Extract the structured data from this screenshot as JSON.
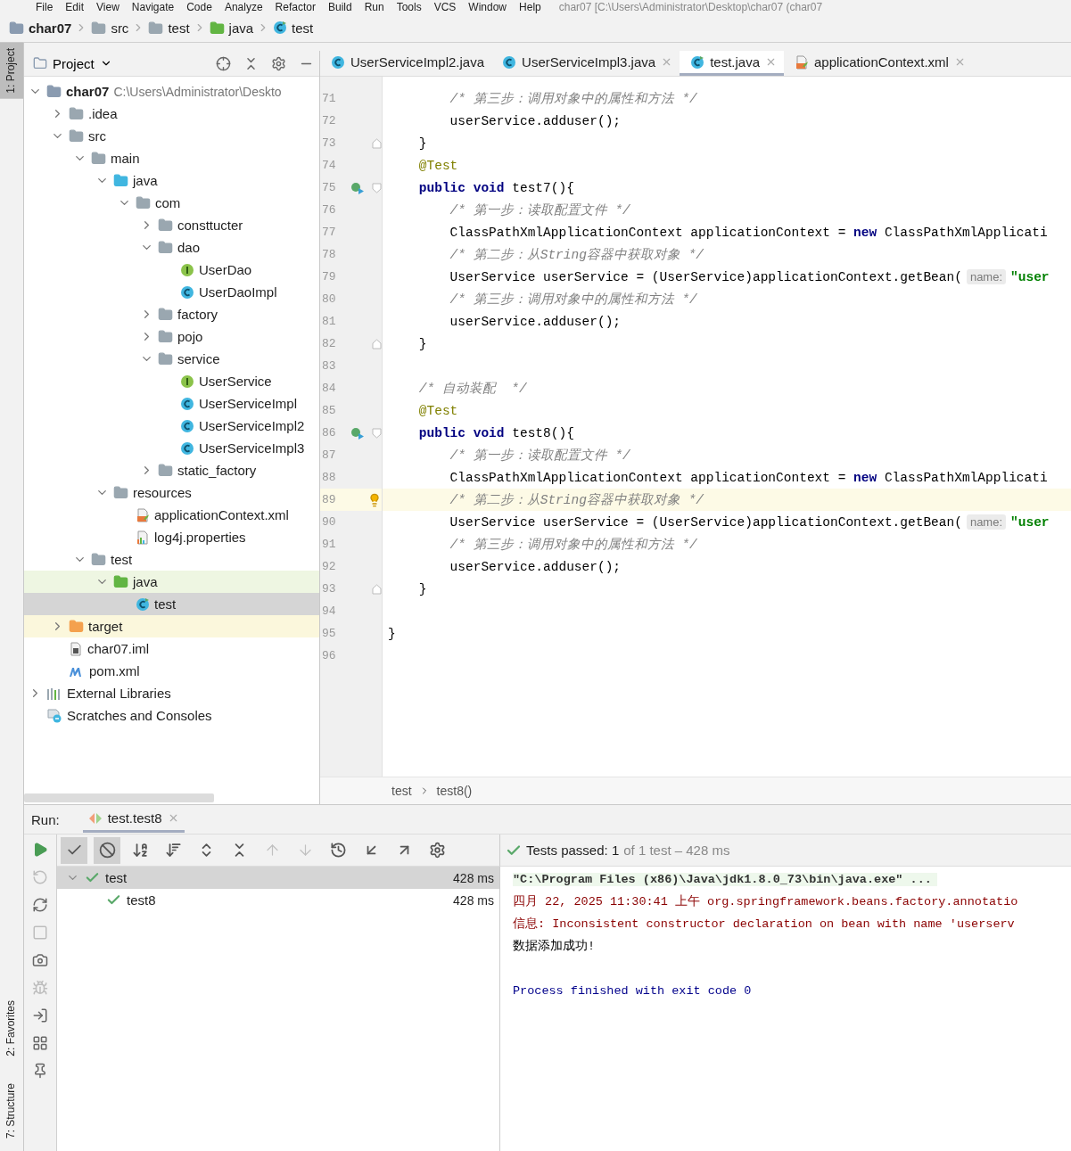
{
  "menu": {
    "items": [
      "File",
      "Edit",
      "View",
      "Navigate",
      "Code",
      "Analyze",
      "Refactor",
      "Build",
      "Run",
      "Tools",
      "VCS",
      "Window",
      "Help"
    ],
    "title": "char07 [C:\\Users\\Administrator\\Desktop\\char07 (char07"
  },
  "breadcrumbs": [
    {
      "label": "char07",
      "kind": "module"
    },
    {
      "label": "src",
      "kind": "folder"
    },
    {
      "label": "test",
      "kind": "folder"
    },
    {
      "label": "java",
      "kind": "test-root"
    },
    {
      "label": "test",
      "kind": "test-class"
    }
  ],
  "tool_windows": {
    "top": [
      {
        "label": "1: Project",
        "selected": true
      }
    ],
    "bottom": [
      {
        "label": "2: Favorites",
        "selected": false
      },
      {
        "label": "7: Structure",
        "selected": false
      }
    ]
  },
  "project": {
    "title": "Project",
    "tree": [
      {
        "label": "char07",
        "kind": "module",
        "detail": "C:\\Users\\Administrator\\Deskto",
        "expanded": true,
        "selected": false,
        "children": [
          {
            "label": ".idea",
            "kind": "folder",
            "expanded": false,
            "selected": false
          },
          {
            "label": "src",
            "kind": "folder",
            "expanded": true,
            "selected": false,
            "children": [
              {
                "label": "main",
                "kind": "folder",
                "expanded": true,
                "selected": false,
                "children": [
                  {
                    "label": "java",
                    "kind": "source-root",
                    "expanded": true,
                    "selected": false,
                    "children": [
                      {
                        "label": "com",
                        "kind": "package",
                        "expanded": true,
                        "selected": false,
                        "children": [
                          {
                            "label": "consttucter",
                            "kind": "package",
                            "expanded": false,
                            "selected": false
                          },
                          {
                            "label": "dao",
                            "kind": "package",
                            "expanded": true,
                            "selected": false,
                            "children": [
                              {
                                "label": "UserDao",
                                "kind": "interface",
                                "selected": false
                              },
                              {
                                "label": "UserDaoImpl",
                                "kind": "class",
                                "selected": false
                              }
                            ]
                          },
                          {
                            "label": "factory",
                            "kind": "package",
                            "expanded": false,
                            "selected": false
                          },
                          {
                            "label": "pojo",
                            "kind": "package",
                            "expanded": false,
                            "selected": false
                          },
                          {
                            "label": "service",
                            "kind": "package",
                            "expanded": true,
                            "selected": false,
                            "children": [
                              {
                                "label": "UserService",
                                "kind": "interface",
                                "selected": false
                              },
                              {
                                "label": "UserServiceImpl",
                                "kind": "class",
                                "selected": false
                              },
                              {
                                "label": "UserServiceImpl2",
                                "kind": "class",
                                "selected": false
                              },
                              {
                                "label": "UserServiceImpl3",
                                "kind": "class",
                                "selected": false
                              }
                            ]
                          },
                          {
                            "label": "static_factory",
                            "kind": "package",
                            "expanded": false,
                            "selected": false
                          }
                        ]
                      }
                    ]
                  },
                  {
                    "label": "resources",
                    "kind": "resources-root",
                    "expanded": true,
                    "selected": false,
                    "children": [
                      {
                        "label": "applicationContext.xml",
                        "kind": "xml",
                        "selected": false
                      },
                      {
                        "label": "log4j.properties",
                        "kind": "properties",
                        "selected": false
                      }
                    ]
                  }
                ]
              },
              {
                "label": "test",
                "kind": "folder",
                "expanded": true,
                "selected": false,
                "children": [
                  {
                    "label": "java",
                    "kind": "test-root",
                    "expanded": true,
                    "selected": false,
                    "children": [
                      {
                        "label": "test",
                        "kind": "test-class",
                        "selected": true
                      }
                    ]
                  }
                ]
              }
            ]
          },
          {
            "label": "target",
            "kind": "excluded",
            "expanded": false,
            "selected": false
          },
          {
            "label": "char07.iml",
            "kind": "iml",
            "selected": false
          },
          {
            "label": "pom.xml",
            "kind": "maven",
            "selected": false
          }
        ]
      },
      {
        "label": "External Libraries",
        "kind": "libraries",
        "expanded": false,
        "selected": false
      },
      {
        "label": "Scratches and Consoles",
        "kind": "scratches",
        "selected": false
      }
    ]
  },
  "editor": {
    "tabs": [
      {
        "label": "UserServiceImpl2.java",
        "kind": "class",
        "selected": false,
        "closable": false
      },
      {
        "label": "UserServiceImpl3.java",
        "kind": "class",
        "selected": false,
        "closable": true
      },
      {
        "label": "test.java",
        "kind": "test-class",
        "selected": true,
        "closable": true
      },
      {
        "label": "applicationContext.xml",
        "kind": "xml",
        "selected": false,
        "closable": true
      }
    ],
    "lines": [
      {
        "n": "71",
        "current": false,
        "tokens": [
          {
            "kind": "comment",
            "text": "        /* 第三步：调用对象中的属性和方法 */"
          }
        ]
      },
      {
        "n": "72",
        "current": false,
        "tokens": [
          {
            "kind": "plain",
            "text": "        userService.adduser();"
          }
        ]
      },
      {
        "n": "73",
        "current": false,
        "gutter": [
          {
            "kind": "fold-end"
          }
        ],
        "tokens": [
          {
            "kind": "plain",
            "text": "    }"
          }
        ]
      },
      {
        "n": "74",
        "current": false,
        "tokens": [
          {
            "kind": "annotation",
            "text": "    @Test"
          }
        ]
      },
      {
        "n": "75",
        "current": false,
        "gutter": [
          {
            "kind": "run"
          },
          {
            "kind": "fold-start"
          }
        ],
        "tokens": [
          {
            "kind": "keyword",
            "text": "    public void"
          },
          {
            "kind": "plain",
            "text": " test7(){"
          }
        ]
      },
      {
        "n": "76",
        "current": false,
        "tokens": [
          {
            "kind": "comment",
            "text": "        /* 第一步：读取配置文件 */"
          }
        ]
      },
      {
        "n": "77",
        "current": false,
        "tokens": [
          {
            "kind": "plain",
            "text": "        ClassPathXmlApplicationContext applicationContext = "
          },
          {
            "kind": "keyword",
            "text": "new"
          },
          {
            "kind": "plain",
            "text": " ClassPathXmlApplicati"
          }
        ]
      },
      {
        "n": "78",
        "current": false,
        "tokens": [
          {
            "kind": "comment",
            "text": "        /* 第二步：从String容器中获取对象 */"
          }
        ]
      },
      {
        "n": "79",
        "current": false,
        "tokens": [
          {
            "kind": "plain",
            "text": "        UserService userService = (UserService)applicationContext.getBean("
          },
          {
            "kind": "hint",
            "text": "name:"
          },
          {
            "kind": "string",
            "text": "\"user"
          }
        ]
      },
      {
        "n": "80",
        "current": false,
        "tokens": [
          {
            "kind": "comment",
            "text": "        /* 第三步：调用对象中的属性和方法 */"
          }
        ]
      },
      {
        "n": "81",
        "current": false,
        "tokens": [
          {
            "kind": "plain",
            "text": "        userService.adduser();"
          }
        ]
      },
      {
        "n": "82",
        "current": false,
        "gutter": [
          {
            "kind": "fold-end"
          }
        ],
        "tokens": [
          {
            "kind": "plain",
            "text": "    }"
          }
        ]
      },
      {
        "n": "83",
        "current": false
      },
      {
        "n": "84",
        "current": false,
        "tokens": [
          {
            "kind": "comment",
            "text": "    /* 自动装配  */"
          }
        ]
      },
      {
        "n": "85",
        "current": false,
        "tokens": [
          {
            "kind": "annotation",
            "text": "    @Test"
          }
        ]
      },
      {
        "n": "86",
        "current": false,
        "gutter": [
          {
            "kind": "run"
          },
          {
            "kind": "fold-start"
          }
        ],
        "tokens": [
          {
            "kind": "keyword",
            "text": "    public void"
          },
          {
            "kind": "plain",
            "text": " test8(){"
          }
        ]
      },
      {
        "n": "87",
        "current": false,
        "tokens": [
          {
            "kind": "comment",
            "text": "        /* 第一步：读取配置文件 */"
          }
        ]
      },
      {
        "n": "88",
        "current": false,
        "tokens": [
          {
            "kind": "plain",
            "text": "        ClassPathXmlApplicationContext applicationContext = "
          },
          {
            "kind": "keyword",
            "text": "new"
          },
          {
            "kind": "plain",
            "text": " ClassPathXmlApplicati"
          }
        ]
      },
      {
        "n": "89",
        "current": true,
        "gutter": [
          {
            "kind": "bulb"
          }
        ],
        "tokens": [
          {
            "kind": "comment",
            "text": "        /* 第二步：从String容器中获取对象 */"
          }
        ]
      },
      {
        "n": "90",
        "current": false,
        "tokens": [
          {
            "kind": "plain",
            "text": "        UserService userService = (UserService)applicationContext.getBean("
          },
          {
            "kind": "hint",
            "text": "name:"
          },
          {
            "kind": "string",
            "text": "\"user"
          }
        ]
      },
      {
        "n": "91",
        "current": false,
        "tokens": [
          {
            "kind": "comment",
            "text": "        /* 第三步：调用对象中的属性和方法 */"
          }
        ]
      },
      {
        "n": "92",
        "current": false,
        "tokens": [
          {
            "kind": "plain",
            "text": "        userService.adduser();"
          }
        ]
      },
      {
        "n": "93",
        "current": false,
        "gutter": [
          {
            "kind": "fold-end"
          }
        ],
        "tokens": [
          {
            "kind": "plain",
            "text": "    }"
          }
        ]
      },
      {
        "n": "94",
        "current": false
      },
      {
        "n": "95",
        "current": false,
        "tokens": [
          {
            "kind": "plain",
            "text": "}"
          }
        ]
      },
      {
        "n": "96",
        "current": false
      }
    ],
    "breadcrumb": [
      "test",
      "test8()"
    ]
  },
  "run": {
    "label": "Run:",
    "tab": {
      "label": "test.test8",
      "selected": true
    },
    "side_buttons": [
      {
        "kind": "play",
        "disabled": false
      },
      {
        "kind": "rerun-failed",
        "disabled": true
      },
      {
        "kind": "auto-test",
        "disabled": false
      },
      {
        "kind": "stop",
        "disabled": true
      },
      {
        "kind": "camera",
        "disabled": false
      },
      {
        "kind": "bug",
        "disabled": true
      },
      {
        "kind": "exit",
        "disabled": false
      },
      {
        "kind": "layout",
        "disabled": false
      },
      {
        "kind": "pin",
        "disabled": false
      }
    ],
    "toolbar": [
      {
        "kind": "check",
        "on": true,
        "disabled": false
      },
      {
        "kind": "ban",
        "on": true,
        "disabled": false
      },
      {
        "kind": "sort-alpha",
        "on": false,
        "disabled": false
      },
      {
        "kind": "sort-duration",
        "on": false,
        "disabled": false
      },
      {
        "kind": "expand",
        "on": false,
        "disabled": false
      },
      {
        "kind": "collapse",
        "on": false,
        "disabled": false
      },
      {
        "kind": "up",
        "on": false,
        "disabled": true
      },
      {
        "kind": "down",
        "on": false,
        "disabled": true
      },
      {
        "kind": "history",
        "on": false,
        "disabled": false
      },
      {
        "kind": "import",
        "on": false,
        "disabled": false
      },
      {
        "kind": "export",
        "on": false,
        "disabled": false
      },
      {
        "kind": "settings",
        "on": false,
        "disabled": false
      }
    ],
    "status": {
      "passed": "Tests passed: 1",
      "rest": "of 1 test – 428 ms"
    },
    "tests": [
      {
        "label": "test",
        "time": "428 ms",
        "passed": true,
        "selected": true,
        "expanded": true,
        "children": [
          {
            "label": "test8",
            "time": "428 ms",
            "passed": true,
            "selected": false
          }
        ]
      }
    ],
    "console": [
      {
        "kind": "command",
        "text": "\"C:\\Program Files (x86)\\Java\\jdk1.8.0_73\\bin\\java.exe\" ..."
      },
      {
        "kind": "stderr",
        "text": "四月 22, 2025 11:30:41 上午 org.springframework.beans.factory.annotatio"
      },
      {
        "kind": "stderr",
        "text": "信息: Inconsistent constructor declaration on bean with name 'userserv"
      },
      {
        "kind": "stdout",
        "text": "数据添加成功!"
      },
      {
        "kind": "blank"
      },
      {
        "kind": "system",
        "text": "Process finished with exit code 0"
      }
    ]
  }
}
